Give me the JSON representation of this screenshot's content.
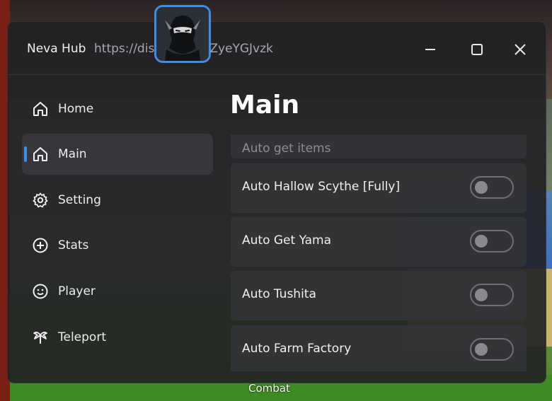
{
  "window": {
    "app_name": "Neva Hub",
    "link_start": "https://dis",
    "link_end": "ZyeYGJvzk"
  },
  "window_controls": [
    "minimize",
    "maximize",
    "close"
  ],
  "sidebar": {
    "items": [
      {
        "label": "Home",
        "icon": "home-icon",
        "active": false
      },
      {
        "label": "Main",
        "icon": "home-icon",
        "active": true
      },
      {
        "label": "Setting",
        "icon": "gear-icon",
        "active": false
      },
      {
        "label": "Stats",
        "icon": "plus-circle-icon",
        "active": false
      },
      {
        "label": "Player",
        "icon": "smiley-icon",
        "active": false
      },
      {
        "label": "Teleport",
        "icon": "teleport-icon",
        "active": false
      }
    ]
  },
  "main": {
    "title": "Main",
    "partial_label": "Auto get items",
    "options": [
      {
        "label": "Auto Hallow Scythe [Fully]",
        "enabled": false
      },
      {
        "label": "Auto Get Yama",
        "enabled": false
      },
      {
        "label": "Auto Tushita",
        "enabled": false
      },
      {
        "label": "Auto Farm Factory",
        "enabled": false
      }
    ]
  },
  "game": {
    "combat_label": "Combat"
  },
  "colors": {
    "accent": "#3d8ee6",
    "panel": "#202022",
    "row": "#343438"
  }
}
